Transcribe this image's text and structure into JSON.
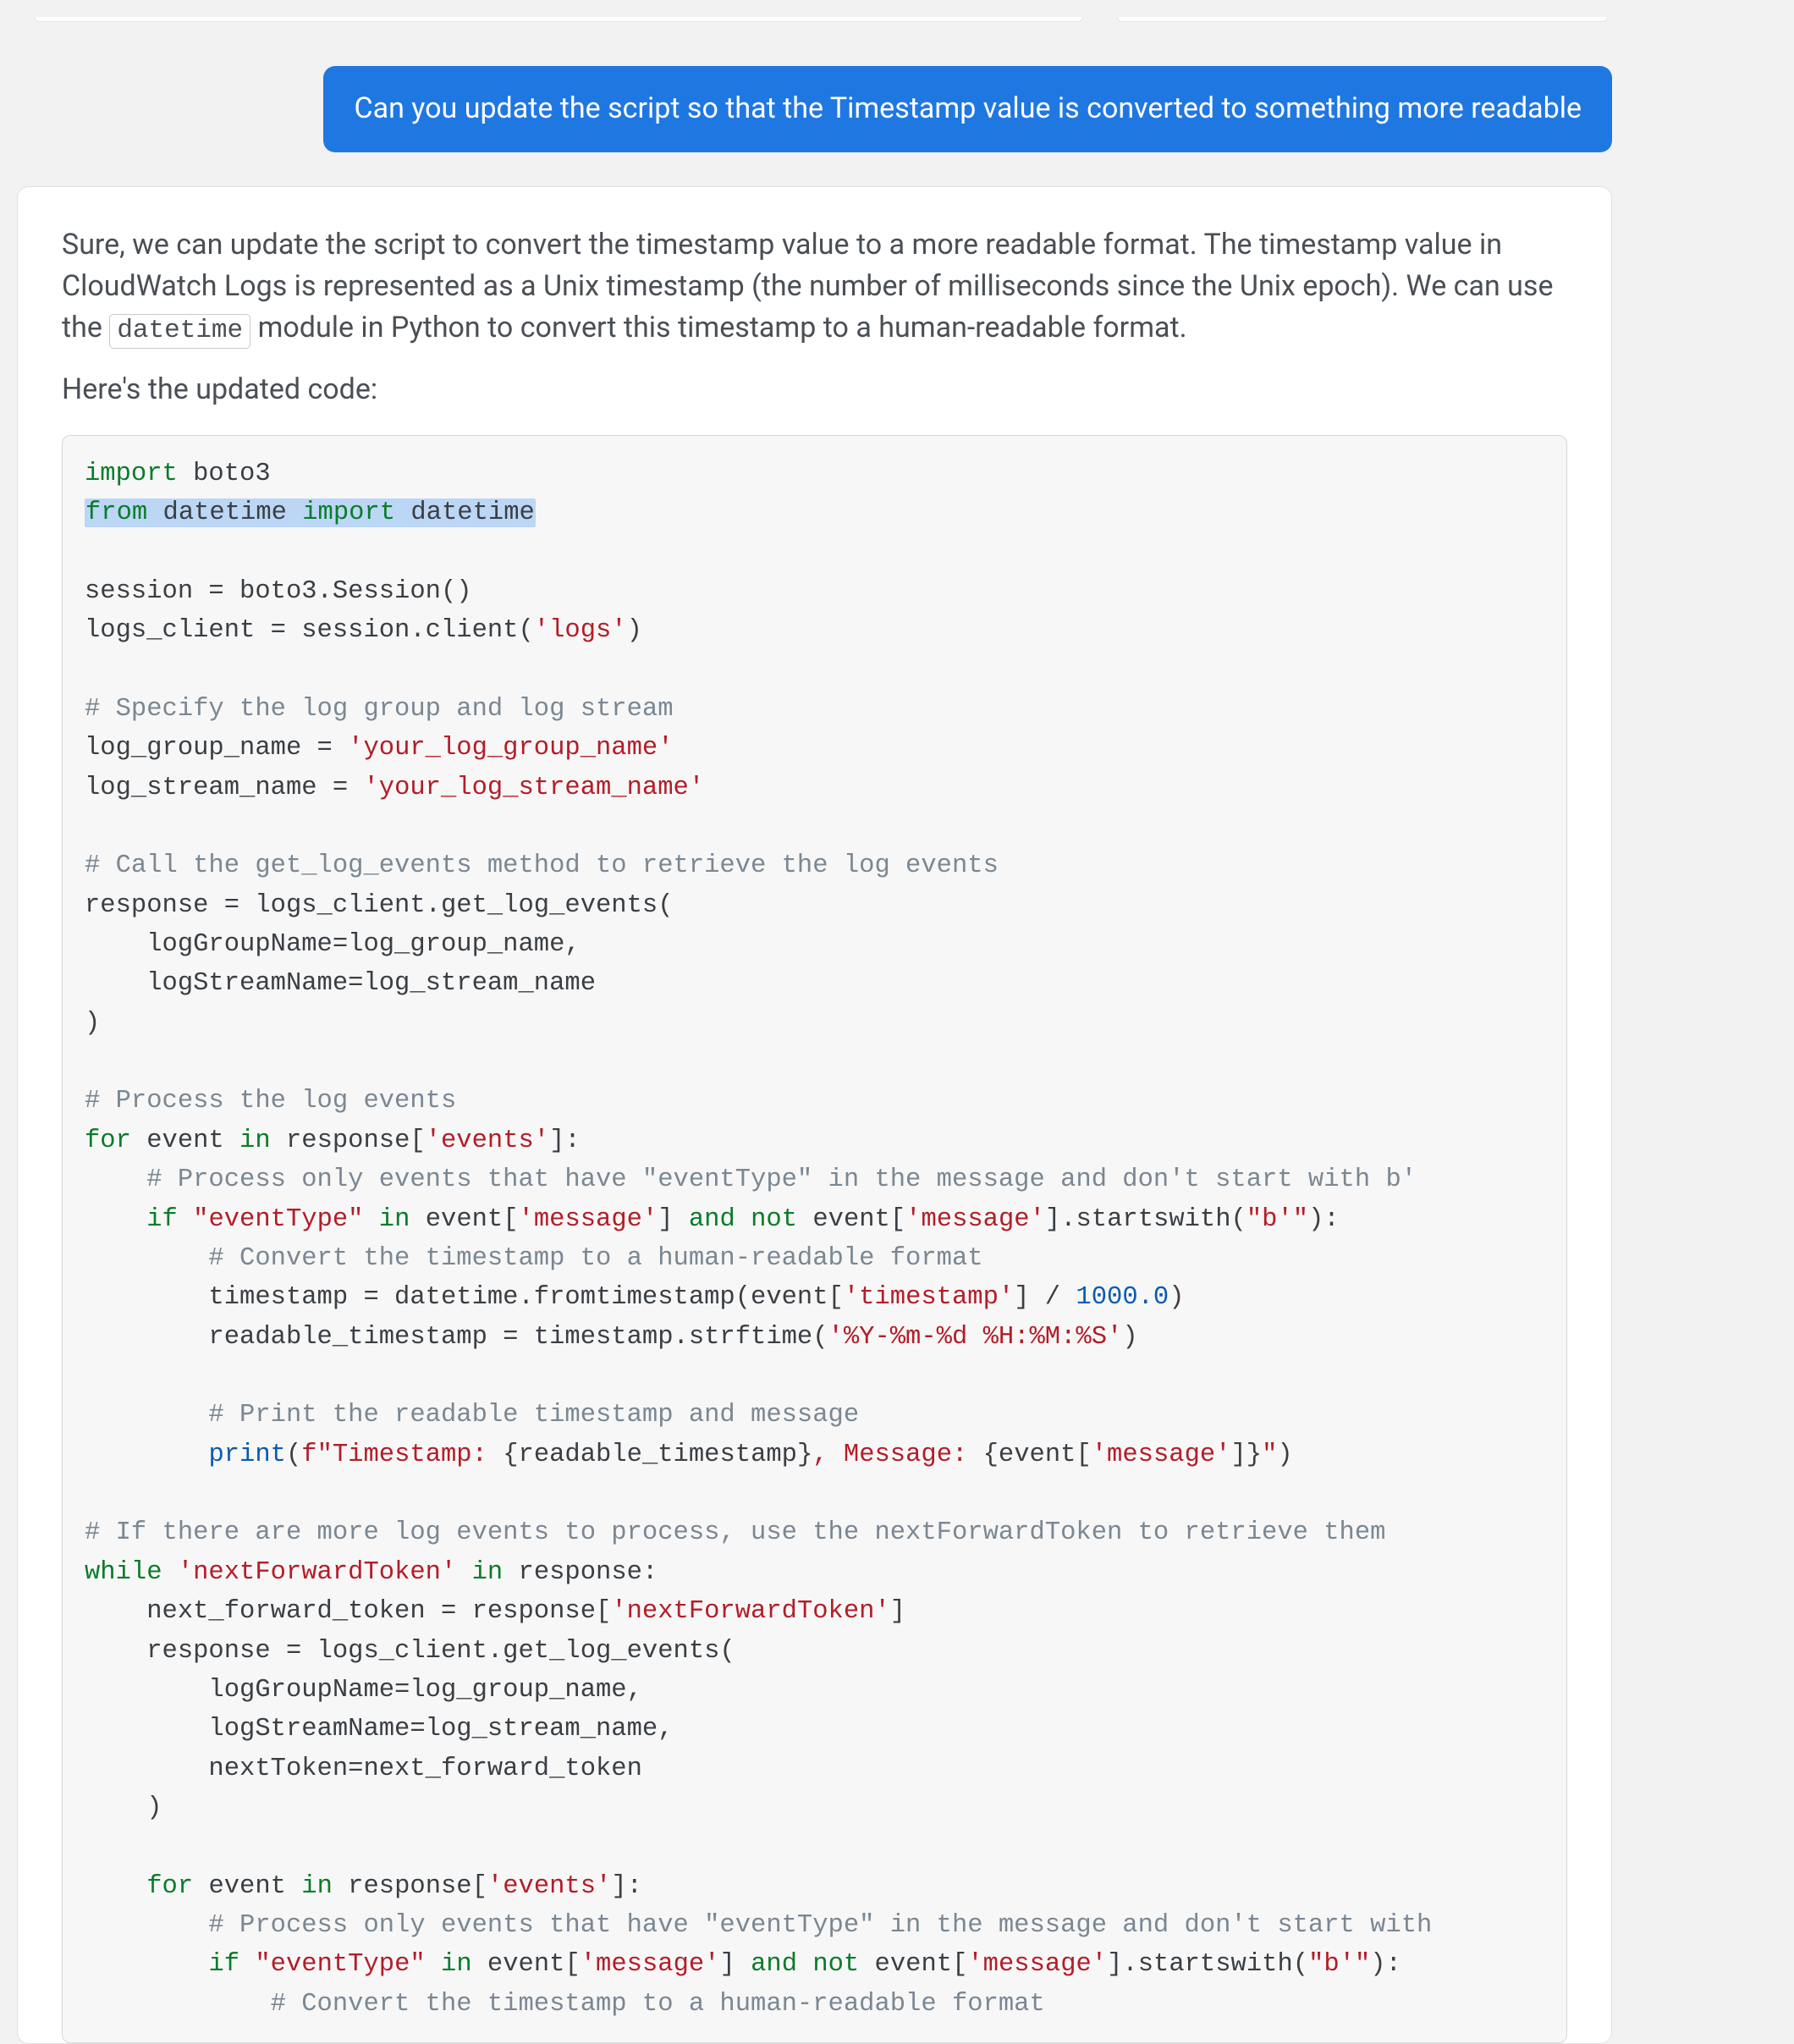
{
  "user_message": "Can you update the script so that the Timestamp value is converted to something more readable",
  "assistant_intro_1a": "Sure, we can update the script to convert the timestamp value to a more readable format. The timestamp value in CloudWatch Logs is represented as a Unix timestamp (the number of milliseconds since the Unix epoch). We can use the ",
  "assistant_inline_code": "datetime",
  "assistant_intro_1b": " module in Python to convert this timestamp to a human-readable format.",
  "assistant_intro_2": "Here's the updated code:",
  "code": {
    "l01_kw1": "import",
    "l01_rest": " boto3",
    "l02_kw1": "from",
    "l02_mid": " datetime ",
    "l02_kw2": "import",
    "l02_end": " datetime",
    "l04": "session = boto3.Session()",
    "l05a": "logs_client = session.client(",
    "l05s": "'logs'",
    "l05b": ")",
    "l07": "# Specify the log group and log stream",
    "l08a": "log_group_name = ",
    "l08s": "'your_log_group_name'",
    "l09a": "log_stream_name = ",
    "l09s": "'your_log_stream_name'",
    "l11": "# Call the get_log_events method to retrieve the log events",
    "l12": "response = logs_client.get_log_events(",
    "l13": "    logGroupName=log_group_name,",
    "l14": "    logStreamName=log_stream_name",
    "l15": ")",
    "l17": "# Process the log events",
    "l18_kw1": "for",
    "l18_mid1": " event ",
    "l18_kw2": "in",
    "l18_mid2": " response[",
    "l18_s": "'events'",
    "l18_end": "]:",
    "l19": "    # Process only events that have \"eventType\" in the message and don't start with b'",
    "l20_pad": "    ",
    "l20_kw1": "if",
    "l20_sp1": " ",
    "l20_s1": "\"eventType\"",
    "l20_sp2": " ",
    "l20_kw2": "in",
    "l20_mid1": " event[",
    "l20_s2": "'message'",
    "l20_mid2": "] ",
    "l20_kw3": "and",
    "l20_sp3": " ",
    "l20_kw4": "not",
    "l20_mid3": " event[",
    "l20_s3": "'message'",
    "l20_mid4": "].startswith(",
    "l20_s4": "\"b'\"",
    "l20_end": "):",
    "l21": "        # Convert the timestamp to a human-readable format",
    "l22a": "        timestamp = datetime.fromtimestamp(event[",
    "l22s": "'timestamp'",
    "l22b": "] / ",
    "l22n": "1000.0",
    "l22c": ")",
    "l23a": "        readable_timestamp = timestamp.strftime(",
    "l23s": "'%Y-%m-%d %H:%M:%S'",
    "l23b": ")",
    "l25": "        # Print the readable timestamp and message",
    "l26pad": "        ",
    "l26fn": "print",
    "l26a": "(",
    "l26f": "f\"Timestamp: ",
    "l26i1a": "{readable_timestamp}",
    "l26m": ", Message: ",
    "l26i2a": "{event[",
    "l26i2s": "'message'",
    "l26i2b": "]}",
    "l26e": "\"",
    "l26c": ")",
    "l28": "# If there are more log events to process, use the nextForwardToken to retrieve them",
    "l29_kw": "while",
    "l29_sp": " ",
    "l29_s": "'nextForwardToken'",
    "l29_sp2": " ",
    "l29_kw2": "in",
    "l29_end": " response:",
    "l30a": "    next_forward_token = response[",
    "l30s": "'nextForwardToken'",
    "l30b": "]",
    "l31": "    response = logs_client.get_log_events(",
    "l32": "        logGroupName=log_group_name,",
    "l33": "        logStreamName=log_stream_name,",
    "l34": "        nextToken=next_forward_token",
    "l35": "    )",
    "l37_pad": "    ",
    "l37_kw1": "for",
    "l37_mid1": " event ",
    "l37_kw2": "in",
    "l37_mid2": " response[",
    "l37_s": "'events'",
    "l37_end": "]:",
    "l38": "        # Process only events that have \"eventType\" in the message and don't start with ",
    "l39_pad": "        ",
    "l39_kw1": "if",
    "l39_sp1": " ",
    "l39_s1": "\"eventType\"",
    "l39_sp2": " ",
    "l39_kw2": "in",
    "l39_mid1": " event[",
    "l39_s2": "'message'",
    "l39_mid2": "] ",
    "l39_kw3": "and",
    "l39_sp3": " ",
    "l39_kw4": "not",
    "l39_mid3": " event[",
    "l39_s3": "'message'",
    "l39_mid4": "].startswith(",
    "l39_s4": "\"b'\"",
    "l39_end": "):",
    "l40": "            # Convert the timestamp to a human-readable format"
  }
}
